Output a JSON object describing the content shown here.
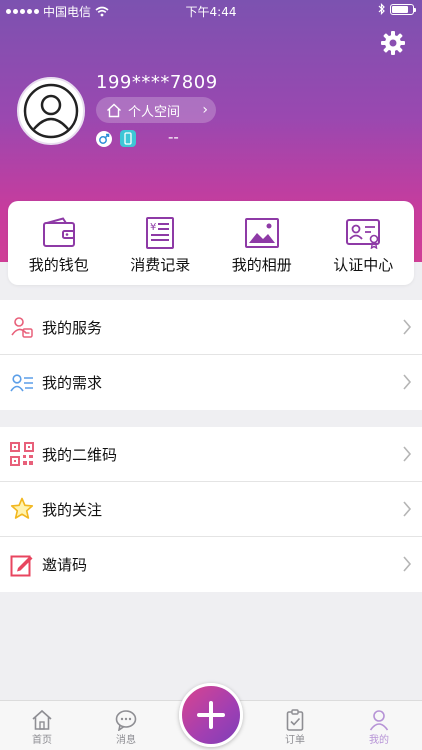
{
  "status_bar": {
    "carrier": "中国电信",
    "time": "下午4:44"
  },
  "profile": {
    "phone": "199****7809",
    "space_label": "个人空间",
    "placeholder": "--"
  },
  "quick_actions": [
    {
      "label": "我的钱包",
      "icon": "wallet-icon"
    },
    {
      "label": "消费记录",
      "icon": "receipt-icon"
    },
    {
      "label": "我的相册",
      "icon": "album-icon"
    },
    {
      "label": "认证中心",
      "icon": "certificate-icon"
    }
  ],
  "menu_group_1": [
    {
      "label": "我的服务",
      "icon": "service-icon"
    },
    {
      "label": "我的需求",
      "icon": "demand-icon"
    }
  ],
  "menu_group_2": [
    {
      "label": "我的二维码",
      "icon": "qrcode-icon"
    },
    {
      "label": "我的关注",
      "icon": "star-icon"
    },
    {
      "label": "邀请码",
      "icon": "invite-edit-icon"
    }
  ],
  "tabbar": {
    "home": "首页",
    "messages": "消息",
    "orders": "订单",
    "mine": "我的"
  },
  "colors": {
    "header_top": "#7c52b0",
    "header_bottom": "#cf3e96",
    "active_tab": "#b693d6"
  }
}
